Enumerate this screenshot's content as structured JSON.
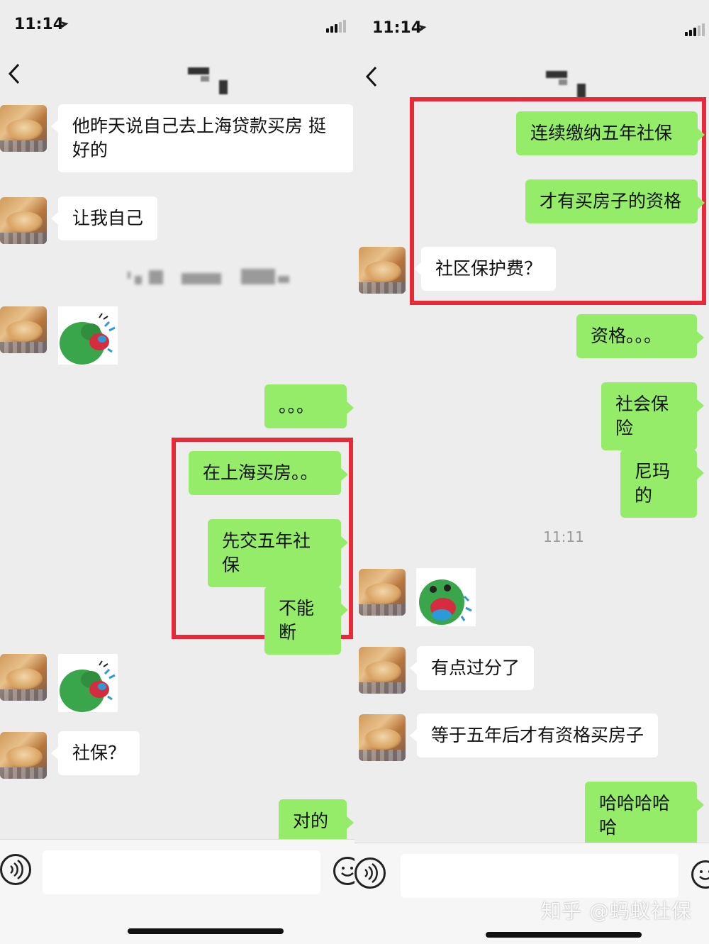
{
  "left": {
    "status": {
      "time": "11:14"
    },
    "messages": [
      {
        "id": "l1",
        "text": "他昨天说自己去上海贷款买房 挺\n好的"
      },
      {
        "id": "l2",
        "text": "让我自己"
      },
      {
        "id": "l4",
        "text": "。。。"
      },
      {
        "id": "l5",
        "text": "在上海买房。。"
      },
      {
        "id": "l6",
        "text": "先交五年社保"
      },
      {
        "id": "l7",
        "text": "不能断"
      },
      {
        "id": "l9",
        "text": "社保？"
      },
      {
        "id": "l10",
        "text": "对的"
      }
    ]
  },
  "right": {
    "status": {
      "time": "11:14"
    },
    "messages": [
      {
        "id": "r1",
        "text": "连续缴纳五年社保"
      },
      {
        "id": "r2",
        "text": "才有买房子的资格"
      },
      {
        "id": "r3",
        "text": "社区保护费？"
      },
      {
        "id": "r4",
        "text": "资格。。。"
      },
      {
        "id": "r5",
        "text": "社会保险"
      },
      {
        "id": "r6",
        "text": "尼玛的"
      },
      {
        "id": "r8",
        "text": "有点过分了"
      },
      {
        "id": "r9",
        "text": "等于五年后才有资格买房子"
      },
      {
        "id": "r10",
        "text": "哈哈哈哈哈"
      }
    ],
    "timestamp": "11:11"
  },
  "icons": [
    "back-arrow-icon",
    "location-arrow-icon",
    "signal-icon",
    "voice-icon",
    "emoji-icon"
  ],
  "colors": {
    "outgoing_bubble": "#95ec69",
    "incoming_bubble": "#ffffff",
    "highlight_box": "#e8293a",
    "chat_background": "#ededed"
  },
  "watermark": "知乎 @蚂蚁社保"
}
